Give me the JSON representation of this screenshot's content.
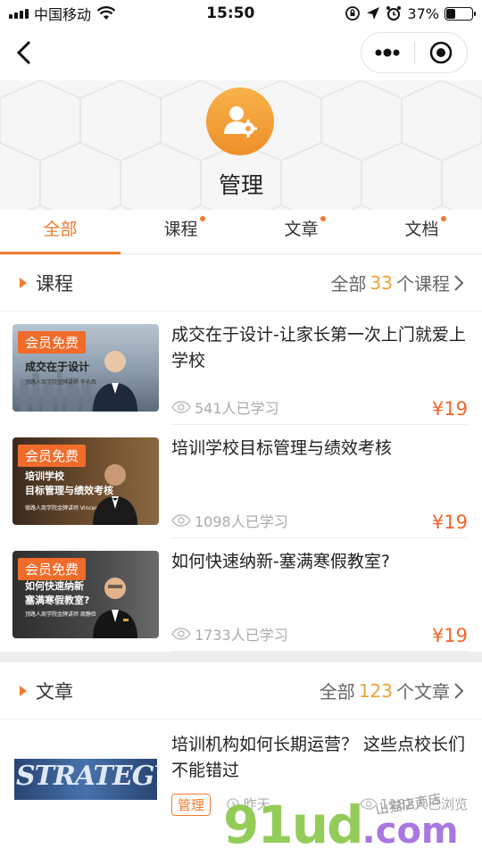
{
  "status": {
    "carrier": "中国移动",
    "time": "15:50",
    "battery": "37%",
    "battery_level": 0.37
  },
  "header": {
    "title": "管理"
  },
  "tabs": [
    {
      "label": "全部",
      "dot": false
    },
    {
      "label": "课程",
      "dot": true
    },
    {
      "label": "文章",
      "dot": true
    },
    {
      "label": "文档",
      "dot": true
    }
  ],
  "course_section": {
    "title": "课程",
    "more_prefix": "全部",
    "count": "33",
    "more_suffix": "个课程"
  },
  "courses": [
    {
      "badge": "会员免费",
      "thumb_text": "成交在于设计",
      "thumb_sub": "顶路人商学院金牌讲师  李永辉",
      "title": "成交在于设计-让家长第一次上门就爱上学校",
      "learners": "541人已学习",
      "price": "¥19"
    },
    {
      "badge": "会员免费",
      "thumb_text": "培训学校\n目标管理与绩效考核",
      "thumb_sub": "德路人商学院金牌讲师  Vincent",
      "title": "培训学校目标管理与绩效考核",
      "learners": "1098人已学习",
      "price": "¥19"
    },
    {
      "badge": "会员免费",
      "thumb_text": "如何快速纳新\n塞满寒假教室?",
      "thumb_sub": "顶路人商学院金牌讲师  周静俭",
      "title": "如何快速纳新-塞满寒假教室?",
      "learners": "1733人已学习",
      "price": "¥19"
    }
  ],
  "article_section": {
    "title": "文章",
    "more_prefix": "全部",
    "count": "123",
    "more_suffix": "个文章"
  },
  "articles": [
    {
      "thumb_text": "STRATEGY",
      "title": "培训机构如何长期运营？ 这些点校长们不能错过",
      "tag": "管理",
      "date": "昨天",
      "views": "1182人已浏览"
    }
  ],
  "watermark": {
    "text": "91ud",
    "suffix": ".com",
    "sub": "山猫店商店"
  }
}
